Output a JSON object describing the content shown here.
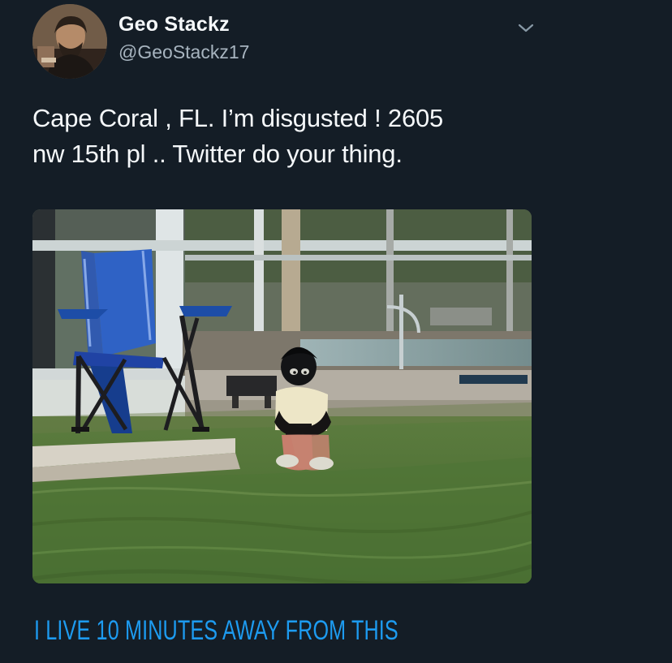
{
  "tweet": {
    "author": {
      "display_name": "Geo Stackz",
      "handle": "@GeoStackz17",
      "avatar_icon": "profile-photo"
    },
    "menu_icon": "chevron-down-icon",
    "text_lines": [
      "Cape Coral , FL. I’m disgusted ! 2605",
      "nw 15th pl .. Twitter do your thing."
    ],
    "media": {
      "type": "photo"
    }
  },
  "caption": "I LIVE 10 MINUTES AWAY FROM THIS",
  "colors": {
    "background": "#141d26",
    "primary_text": "#f5f8fa",
    "secondary_text": "#a7b4bf",
    "caption_blue": "#1d9bf0"
  }
}
